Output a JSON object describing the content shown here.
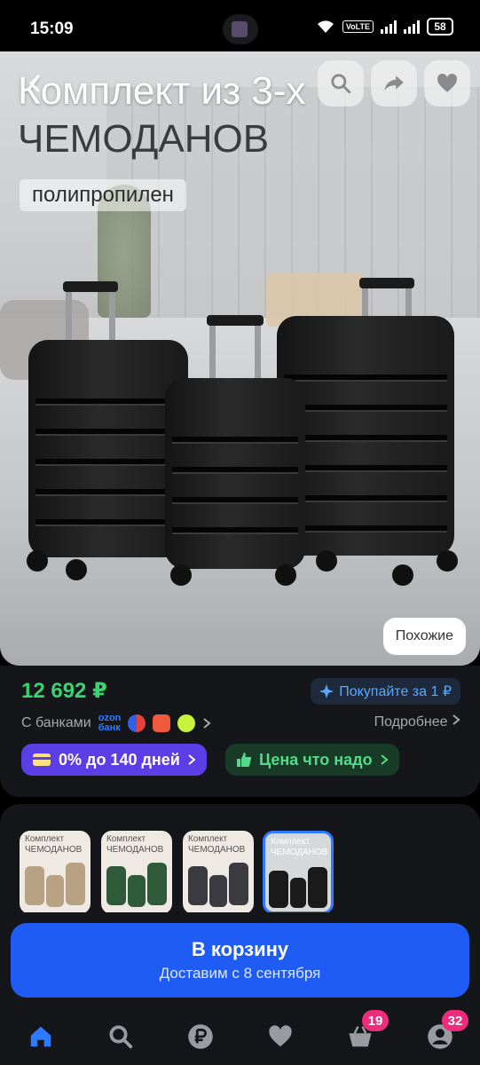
{
  "status_bar": {
    "time": "15:09",
    "network": "VoLTE",
    "battery": "58",
    "icons": [
      "wifi-icon",
      "signal-icon",
      "battery-icon"
    ]
  },
  "product": {
    "image_title_line1": "Комплект из 3-х",
    "image_title_line2": "ЧЕМОДАНОВ",
    "image_subtitle": "полипропилен",
    "similar_label": "Похожие",
    "price": "12 692 ₽",
    "buy_badge": "Покупайте за 1 ₽",
    "banks_label": "С банками",
    "bank_logos": [
      "ozon-bank",
      "sber",
      "tinkoff",
      "cashback"
    ],
    "more_label": "Подробнее",
    "credit_pill": "0% до 140 дней",
    "price_pill": "Цена что надо"
  },
  "hero_buttons": [
    "back-icon",
    "search-icon",
    "share-icon",
    "heart-icon"
  ],
  "variants": [
    {
      "title": "Комплект ЧЕМОДАНОВ",
      "color": "#b8a182",
      "selected": false
    },
    {
      "title": "Комплект ЧЕМОДАНОВ",
      "color": "#2f5a3a",
      "selected": false
    },
    {
      "title": "Комплект ЧЕМОДАНОВ",
      "color": "#3a3a40",
      "selected": false
    },
    {
      "title": "Комплект ЧЕМОДАНОВ",
      "color": "#1a1a1a",
      "selected": true
    }
  ],
  "cart": {
    "title": "В корзину",
    "subtitle": "Доставим с 8 сентября"
  },
  "nav": {
    "items": [
      "home-icon",
      "search-icon",
      "ruble-icon",
      "heart-icon",
      "basket-icon",
      "profile-icon"
    ],
    "basket_badge": "19",
    "profile_badge": "32"
  },
  "colors": {
    "accent_blue": "#1f5bf5",
    "price_green": "#39d372",
    "credit_purple": "#5b3ee6",
    "badge_pink": "#ee2c7b"
  }
}
